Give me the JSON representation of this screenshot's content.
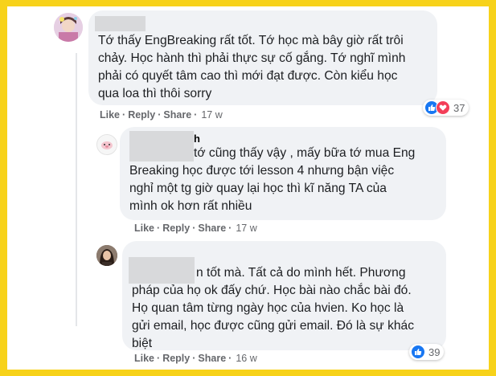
{
  "comments": [
    {
      "author_suffix": "",
      "text": "Tớ thấy EngBreaking rất tốt. Tớ học mà bây giờ rất trôi\nchảy. Học hành thì phải thực sự cố gắng. Tớ nghĩ mình\nphải có quyết tâm cao thì mới đạt được. Còn kiểu học\nqua loa thì thôi sorry",
      "like": "Like",
      "reply": "Reply",
      "share": "Share",
      "time": "17 w",
      "reaction_count": "37",
      "reactions": [
        "like-reaction",
        "love-reaction"
      ]
    },
    {
      "author_suffix": "h",
      "text": "tớ cũng thấy vậy , mấy bữa tớ mua Eng\nBreaking học được tới lesson 4 nhưng bận việc\nnghỉ một tg giờ quay lại học thì kĩ năng TA của\nmình ok hơn rất nhiều",
      "like": "Like",
      "reply": "Reply",
      "share": "Share",
      "time": "17 w"
    },
    {
      "author_suffix": "",
      "text": "n tốt mà. Tất cả do mình hết. Phương\npháp của họ ok đấy chứ. Học bài nào chắc bài đó.\nHọ quan tâm từng ngày học của hvien. Ko học là\ngửi email, học được cũng gửi email. Đó là sự khác\nbiệt",
      "like": "Like",
      "reply": "Reply",
      "share": "Share",
      "time": "16 w",
      "reaction_count": "39",
      "reactions": [
        "like-reaction"
      ]
    }
  ],
  "colors": {
    "frame_border": "#f7d21a",
    "bubble": "#f0f2f5",
    "like_blue": "#1877f2",
    "love_red": "#f33e58",
    "meta_gray": "#65676b"
  }
}
